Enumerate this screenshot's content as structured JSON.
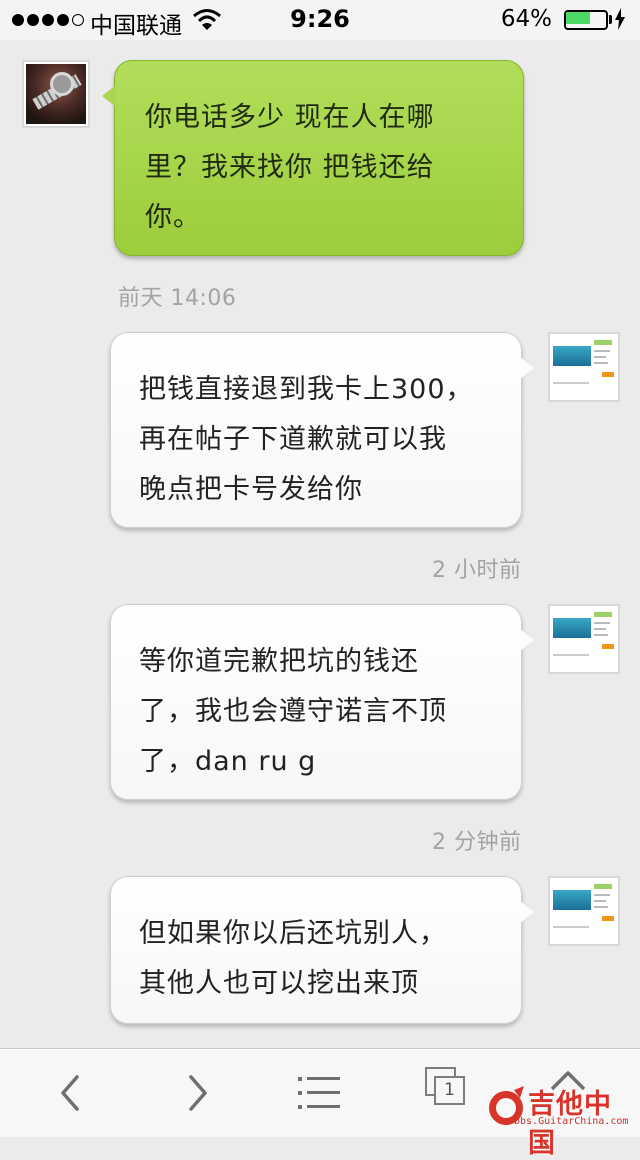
{
  "status_bar": {
    "carrier": "中国联通",
    "time": "9:26",
    "battery_percent": "64%",
    "battery_level": 0.64
  },
  "messages": [
    {
      "side": "left",
      "color": "green",
      "lines": [
        "你电话多少  现在人在哪",
        "里？我来找你  把钱还给",
        "你。"
      ],
      "timestamp": "前天 14:06"
    },
    {
      "side": "right",
      "color": "white",
      "lines": [
        "把钱直接退到我卡上300，",
        "再在帖子下道歉就可以我",
        "晚点把卡号发给你"
      ],
      "timestamp": "2 小时前"
    },
    {
      "side": "right",
      "color": "white",
      "lines": [
        "等你道完歉把坑的钱还",
        "了，我也会遵守诺言不顶",
        "了，dan ru g"
      ],
      "timestamp": "2 分钟前"
    },
    {
      "side": "right",
      "color": "white",
      "lines": [
        "但如果你以后还坑别人，",
        "其他人也可以挖出来顶"
      ]
    }
  ],
  "toolbar": {
    "tab_count": "1",
    "icons": [
      "back-icon",
      "forward-icon",
      "bookmarks-icon",
      "tabs-icon",
      "home-icon"
    ]
  },
  "watermark": {
    "title": "吉他中国",
    "subtitle": "bbs.GuitarChina.com"
  },
  "colors": {
    "green_bubble": "#a6d24b",
    "white_bubble": "#ffffff",
    "background": "#ebebeb",
    "timestamp": "#a3a3a3"
  }
}
